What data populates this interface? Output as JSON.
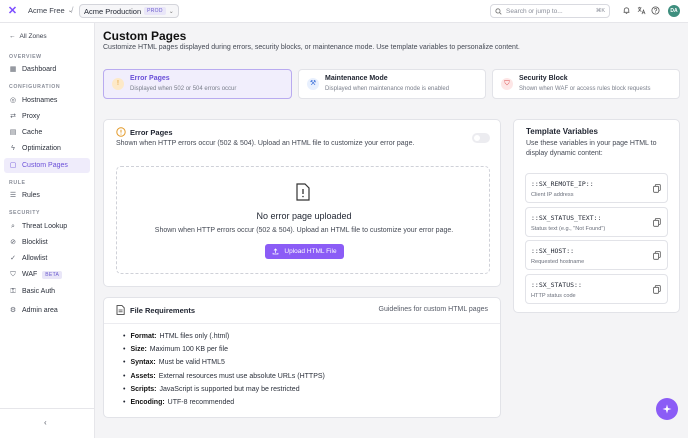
{
  "topbar": {
    "org_name": "Acme Free",
    "zone_name": "Acme Production",
    "zone_badge": "PROD",
    "search_placeholder": "Search or jump to...",
    "search_shortcut": "⌘K",
    "avatar_initials": "DA"
  },
  "sidebar": {
    "all_zones": "All Zones",
    "sections": [
      {
        "title": "OVERVIEW",
        "items": [
          {
            "label": "Dashboard"
          }
        ]
      },
      {
        "title": "CONFIGURATION",
        "items": [
          {
            "label": "Hostnames"
          },
          {
            "label": "Proxy"
          },
          {
            "label": "Cache"
          },
          {
            "label": "Optimization"
          },
          {
            "label": "Custom Pages"
          }
        ]
      },
      {
        "title": "RULE",
        "items": [
          {
            "label": "Rules"
          }
        ]
      },
      {
        "title": "SECURITY",
        "items": [
          {
            "label": "Threat Lookup"
          },
          {
            "label": "Blocklist"
          },
          {
            "label": "Allowlist"
          },
          {
            "label": "WAF",
            "badge": "BETA"
          },
          {
            "label": "Basic Auth"
          }
        ]
      },
      {
        "title": "",
        "items": [
          {
            "label": "Admin area"
          }
        ]
      }
    ]
  },
  "page": {
    "title": "Custom Pages",
    "subtitle": "Customize HTML pages displayed during errors, security blocks, or maintenance mode. Use template variables to personalize content."
  },
  "tabs": [
    {
      "title": "Error Pages",
      "desc": "Displayed when 502 or 504 errors occur"
    },
    {
      "title": "Maintenance Mode",
      "desc": "Displayed when maintenance mode is enabled"
    },
    {
      "title": "Security Block",
      "desc": "Shown when WAF or access rules block requests"
    }
  ],
  "error_card": {
    "title": "Error Pages",
    "desc": "Shown when HTTP errors occur (502 & 504). Upload an HTML file to customize your error page.",
    "empty_title": "No error page uploaded",
    "empty_desc": "Shown when HTTP errors occur (502 & 504). Upload an HTML file to customize your error page.",
    "upload_label": "Upload HTML File"
  },
  "requirements": {
    "title": "File Requirements",
    "right": "Guidelines for custom HTML pages",
    "items": [
      {
        "k": "Format:",
        "v": "HTML files only (.html)"
      },
      {
        "k": "Size:",
        "v": "Maximum 100 KB per file"
      },
      {
        "k": "Syntax:",
        "v": "Must be valid HTML5"
      },
      {
        "k": "Assets:",
        "v": "External resources must use absolute URLs (HTTPS)"
      },
      {
        "k": "Scripts:",
        "v": "JavaScript is supported but may be restricted"
      },
      {
        "k": "Encoding:",
        "v": "UTF-8 recommended"
      }
    ]
  },
  "template_vars": {
    "title": "Template Variables",
    "desc": "Use these variables in your page HTML to display dynamic content:",
    "vars": [
      {
        "name": "::SX_REMOTE_IP::",
        "desc": "Client IP address"
      },
      {
        "name": "::SX_STATUS_TEXT::",
        "desc": "Status text (e.g., \"Not Found\")"
      },
      {
        "name": "::SX_HOST::",
        "desc": "Requested hostname"
      },
      {
        "name": "::SX_STATUS::",
        "desc": "HTTP status code"
      }
    ]
  },
  "colors": {
    "accent": "#8b5cf6",
    "accent_soft": "#efecfb"
  }
}
